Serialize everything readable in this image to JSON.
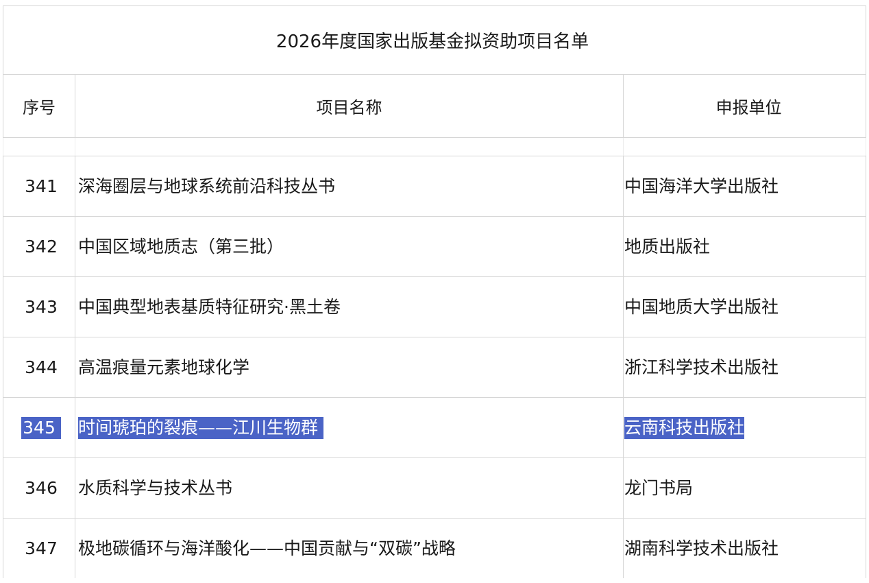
{
  "table": {
    "title": "2026年度国家出版基金拟资助项目名单",
    "headers": {
      "index": "序号",
      "project": "项目名称",
      "publisher": "申报单位"
    },
    "rows": [
      {
        "index": "341",
        "project": "深海圈层与地球系统前沿科技丛书",
        "publisher": "中国海洋大学出版社"
      },
      {
        "index": "342",
        "project": "中国区域地质志（第三批）",
        "publisher": "地质出版社"
      },
      {
        "index": "343",
        "project": "中国典型地表基质特征研究·黑土卷",
        "publisher": "中国地质大学出版社"
      },
      {
        "index": "344",
        "project": "高温痕量元素地球化学",
        "publisher": "浙江科学技术出版社"
      },
      {
        "index": "345",
        "project": "时间琥珀的裂痕——江川生物群",
        "publisher": "云南科技出版社",
        "selected": true
      },
      {
        "index": "346",
        "project": "水质科学与技术丛书",
        "publisher": "龙门书局"
      },
      {
        "index": "347",
        "project": "极地碳循环与海洋酸化——中国贡献与“双碳”战略",
        "publisher": "湖南科学技术出版社"
      }
    ]
  },
  "colors": {
    "selection": "#4a63c6",
    "grid": "#d6d6d6"
  }
}
